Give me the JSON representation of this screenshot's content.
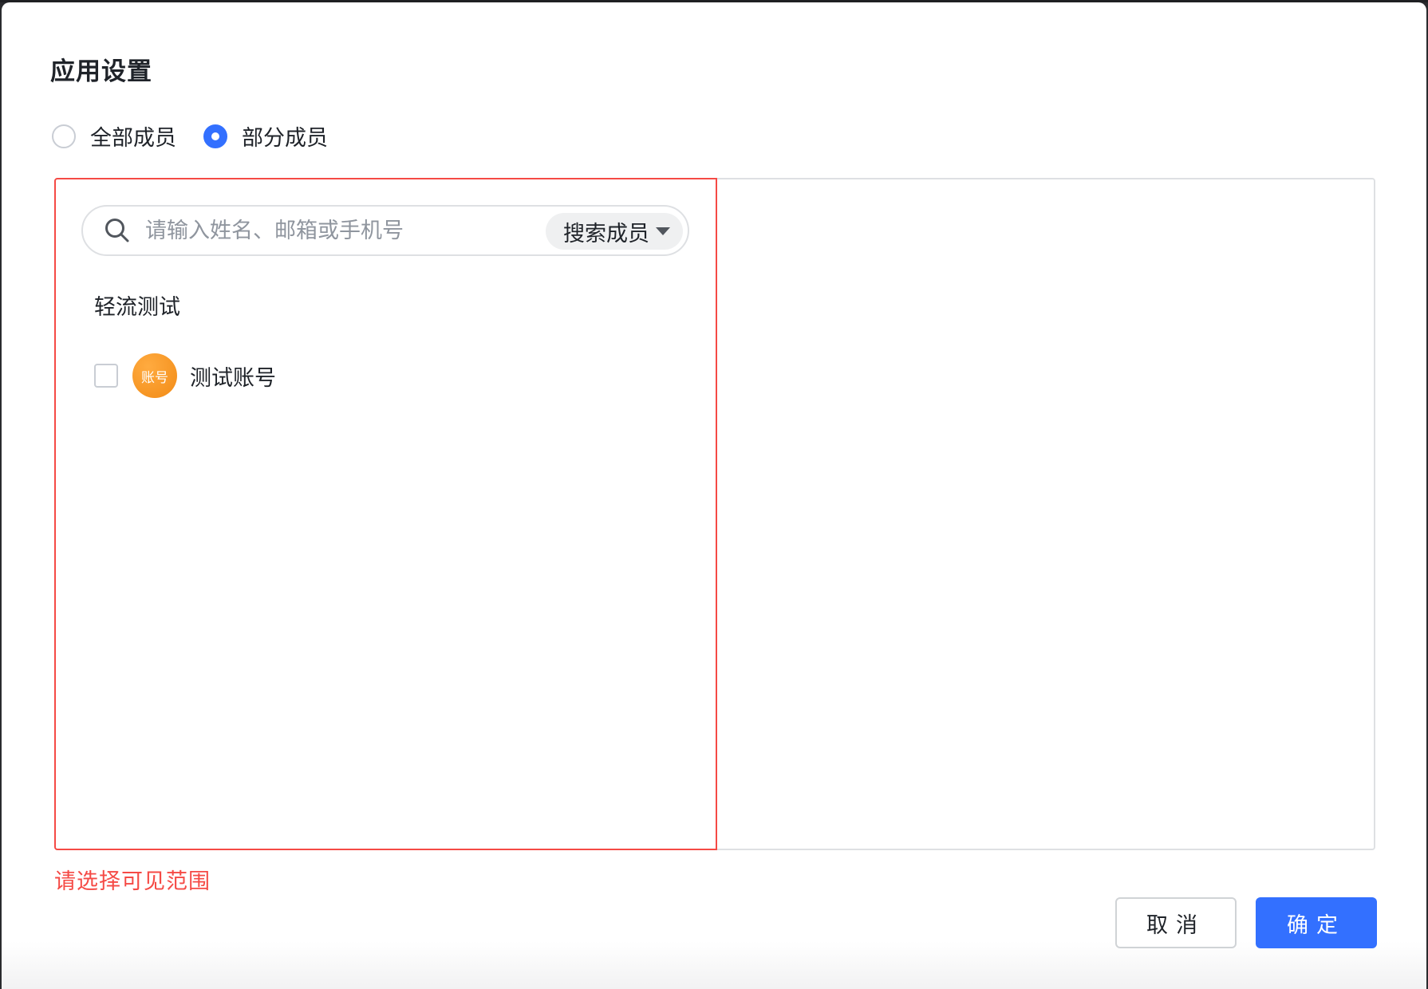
{
  "dialog": {
    "title": "应用设置",
    "scope_options": [
      {
        "label": "全部成员",
        "checked": false
      },
      {
        "label": "部分成员",
        "checked": true
      }
    ],
    "search": {
      "placeholder": "请输入姓名、邮箱或手机号",
      "value": "",
      "scope_label": "搜索成员",
      "icon": "search-icon"
    },
    "group": {
      "title": "轻流测试",
      "members": [
        {
          "name": "测试账号",
          "avatar_text": "账号",
          "avatar_color": "#f28b16",
          "checked": false
        }
      ]
    },
    "error_message": "请选择可见范围",
    "buttons": {
      "cancel": "取消",
      "confirm": "确定"
    },
    "colors": {
      "primary": "#3370ff",
      "error": "#f54a45"
    }
  }
}
